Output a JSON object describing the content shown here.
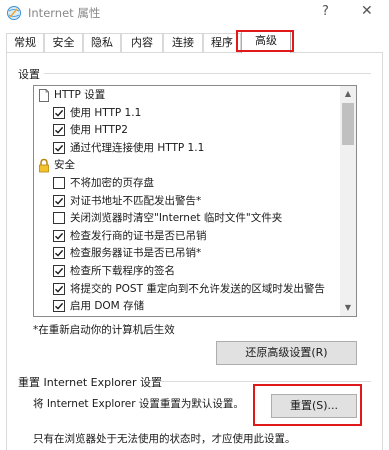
{
  "window": {
    "title": "Internet 属性",
    "help_glyph": "?",
    "close_glyph": "✕"
  },
  "tabs": [
    {
      "label": "常规",
      "active": false
    },
    {
      "label": "安全",
      "active": false
    },
    {
      "label": "隐私",
      "active": false
    },
    {
      "label": "内容",
      "active": false
    },
    {
      "label": "连接",
      "active": false
    },
    {
      "label": "程序",
      "active": false
    },
    {
      "label": "高级",
      "active": true
    }
  ],
  "highlight_color": "#e01a1a",
  "settings": {
    "group_label": "设置",
    "items": [
      {
        "kind": "category",
        "icon": "page-icon",
        "label": "HTTP 设置"
      },
      {
        "kind": "checkbox",
        "checked": true,
        "label": "使用 HTTP 1.1"
      },
      {
        "kind": "checkbox",
        "checked": true,
        "label": "使用 HTTP2"
      },
      {
        "kind": "checkbox",
        "checked": true,
        "label": "通过代理连接使用 HTTP 1.1"
      },
      {
        "kind": "category",
        "icon": "lock-icon",
        "label": "安全"
      },
      {
        "kind": "checkbox",
        "checked": false,
        "label": "不将加密的页存盘"
      },
      {
        "kind": "checkbox",
        "checked": true,
        "label": "对证书地址不匹配发出警告*"
      },
      {
        "kind": "checkbox",
        "checked": false,
        "label": "关闭浏览器时清空\"Internet 临时文件\"文件夹"
      },
      {
        "kind": "checkbox",
        "checked": true,
        "label": "检查发行商的证书是否已吊销"
      },
      {
        "kind": "checkbox",
        "checked": true,
        "label": "检查服务器证书是否已吊销*"
      },
      {
        "kind": "checkbox",
        "checked": true,
        "label": "检查所下载程序的签名"
      },
      {
        "kind": "checkbox",
        "checked": true,
        "label": "将提交的 POST 重定向到不允许发送的区域时发出警告"
      },
      {
        "kind": "checkbox",
        "checked": true,
        "label": "启用 DOM 存储"
      }
    ],
    "restart_note": "*在重新启动你的计算机后生效",
    "restore_button": "还原高级设置(R)"
  },
  "reset": {
    "group_label": "重置 Internet Explorer 设置",
    "description": "将 Internet Explorer 设置重置为默认设置。",
    "button": "重置(S)...",
    "note": "只有在浏览器处于无法使用的状态时，才应使用此设置。"
  }
}
